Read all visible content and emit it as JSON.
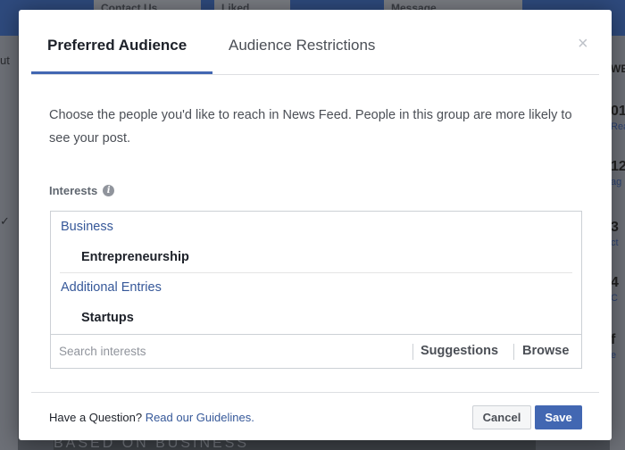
{
  "background": {
    "top_buttons": [
      "Contact Us",
      "Liked",
      "Message"
    ],
    "left_fragments": [
      "ut",
      "✓"
    ],
    "right_fragments": [
      "WE",
      "01",
      "Rea",
      "12",
      "ag",
      "3",
      "ct",
      "4",
      "C",
      "f",
      "e"
    ],
    "bottom_text": "BASED ON BUSINESS"
  },
  "dialog": {
    "tabs": [
      {
        "label": "Preferred Audience",
        "active": true
      },
      {
        "label": "Audience Restrictions",
        "active": false
      }
    ],
    "close_glyph": "×",
    "description": "Choose the people you'd like to reach in News Feed. People in this group are more likely to see your post.",
    "interests": {
      "label": "Interests",
      "info_glyph": "i",
      "groups": [
        {
          "category": "Business",
          "items": [
            "Entrepreneurship"
          ]
        },
        {
          "category": "Additional Entries",
          "items": [
            "Startups"
          ]
        }
      ],
      "search_placeholder": "Search interests",
      "search_value": "",
      "suggestions_label": "Suggestions",
      "browse_label": "Browse"
    },
    "footer": {
      "question": "Have a Question?",
      "guidelines_link": "Read our Guidelines."
    },
    "buttons": {
      "cancel": "Cancel",
      "save": "Save"
    },
    "colors": {
      "accent": "#4267b2",
      "link": "#365899",
      "active_tab_text": "#1d2129"
    }
  }
}
